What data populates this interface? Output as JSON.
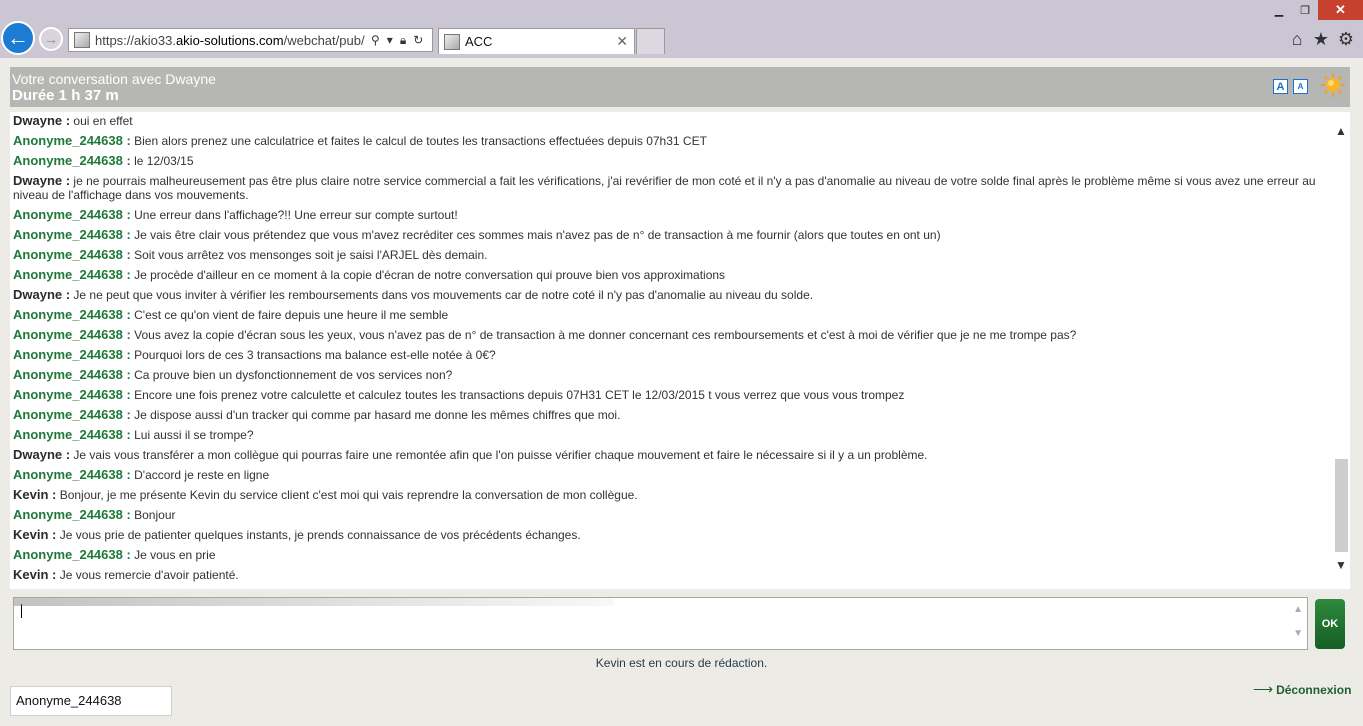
{
  "browser": {
    "url_prefix": "https://akio33.",
    "url_domain": "akio-solutions.com",
    "url_suffix": "/webchat/pub/pa",
    "tab_title": "ACC",
    "win_min": "▁",
    "win_max": "❐",
    "win_close": "✕"
  },
  "header": {
    "title": "Votre conversation avec Dwayne",
    "duration": "Durée 1 h 37 m",
    "font_up": "A",
    "font_down": "A"
  },
  "messages": [
    {
      "sender": "Dwayne :",
      "role": "agent",
      "text": "oui en effet"
    },
    {
      "sender": "Anonyme_244638 :",
      "role": "user",
      "text": "Bien alors prenez une calculatrice et faites le calcul de toutes les transactions effectuées depuis 07h31 CET"
    },
    {
      "sender": "Anonyme_244638 :",
      "role": "user",
      "text": "le 12/03/15"
    },
    {
      "sender": "Dwayne :",
      "role": "agent",
      "text": "je ne pourrais malheureusement pas être plus claire notre service commercial a fait les vérifications, j'ai revérifier de mon coté et il n'y a pas d'anomalie au niveau de votre solde final après le problème même si vous avez une erreur au niveau de l'affichage dans vos mouvements."
    },
    {
      "sender": "Anonyme_244638 :",
      "role": "user",
      "text": "Une erreur dans l'affichage?!! Une erreur sur compte surtout!"
    },
    {
      "sender": "Anonyme_244638 :",
      "role": "user",
      "text": "Je vais être clair vous prétendez que vous m'avez recréditer ces sommes mais n'avez pas de n° de transaction à me fournir (alors que toutes en ont un)"
    },
    {
      "sender": "Anonyme_244638 :",
      "role": "user",
      "text": "Soit vous arrêtez vos mensonges soit je saisi l'ARJEL dès demain."
    },
    {
      "sender": "Anonyme_244638 :",
      "role": "user",
      "text": "Je procède d'ailleur en ce moment à la copie d'écran de notre conversation qui prouve bien vos approximations"
    },
    {
      "sender": "Dwayne :",
      "role": "agent",
      "text": "Je ne peut que vous inviter à vérifier les remboursements dans vos mouvements car de notre coté il n'y pas d'anomalie au niveau du solde."
    },
    {
      "sender": "Anonyme_244638 :",
      "role": "user",
      "text": "C'est ce qu'on vient de faire depuis une heure il me semble"
    },
    {
      "sender": "Anonyme_244638 :",
      "role": "user",
      "text": "Vous avez la copie d'écran sous les yeux, vous n'avez pas de n° de transaction à me donner concernant ces remboursements et c'est à moi de vérifier que je ne me trompe pas?"
    },
    {
      "sender": "Anonyme_244638 :",
      "role": "user",
      "text": "Pourquoi lors de ces 3 transactions ma balance est-elle notée à 0€?"
    },
    {
      "sender": "Anonyme_244638 :",
      "role": "user",
      "text": "Ca prouve bien un dysfonctionnement de vos services non?"
    },
    {
      "sender": "Anonyme_244638 :",
      "role": "user",
      "text": "Encore une fois prenez votre calculette et calculez toutes les transactions depuis 07H31 CET le 12/03/2015 t vous verrez que vous vous trompez"
    },
    {
      "sender": "Anonyme_244638 :",
      "role": "user",
      "text": "Je dispose aussi d'un tracker qui comme par hasard me donne les mêmes chiffres que moi."
    },
    {
      "sender": "Anonyme_244638 :",
      "role": "user",
      "text": "Lui aussi il se trompe?"
    },
    {
      "sender": "Dwayne :",
      "role": "agent",
      "text": "Je vais vous transférer a mon collègue qui pourras faire une remontée afin que l'on puisse vérifier chaque mouvement et faire le nécessaire si il y a un problème."
    },
    {
      "sender": "Anonyme_244638 :",
      "role": "user",
      "text": "D'accord je reste en ligne"
    },
    {
      "sender": "Kevin :",
      "role": "agent",
      "text": "Bonjour, je me présente Kevin du service client c'est moi qui vais reprendre la conversation de mon collègue."
    },
    {
      "sender": "Anonyme_244638 :",
      "role": "user",
      "text": "Bonjour"
    },
    {
      "sender": "Kevin :",
      "role": "agent",
      "text": "Je vous prie de patienter quelques instants, je prends connaissance de vos précédents échanges."
    },
    {
      "sender": "Anonyme_244638 :",
      "role": "user",
      "text": "Je vous en prie"
    },
    {
      "sender": "Kevin :",
      "role": "agent",
      "text": "Je vous remercie d'avoir patienté."
    }
  ],
  "composer": {
    "ok_label": "OK",
    "typing_status": "Kevin est en cours de rédaction.",
    "username": "Anonyme_244638",
    "disconnect_label": "Déconnexion"
  },
  "colors": {
    "user_sender": "#1f7a3a",
    "agent_sender": "#2b2b2b",
    "header_bg": "#b6b6b4",
    "ok_button": "#1f7a33"
  }
}
